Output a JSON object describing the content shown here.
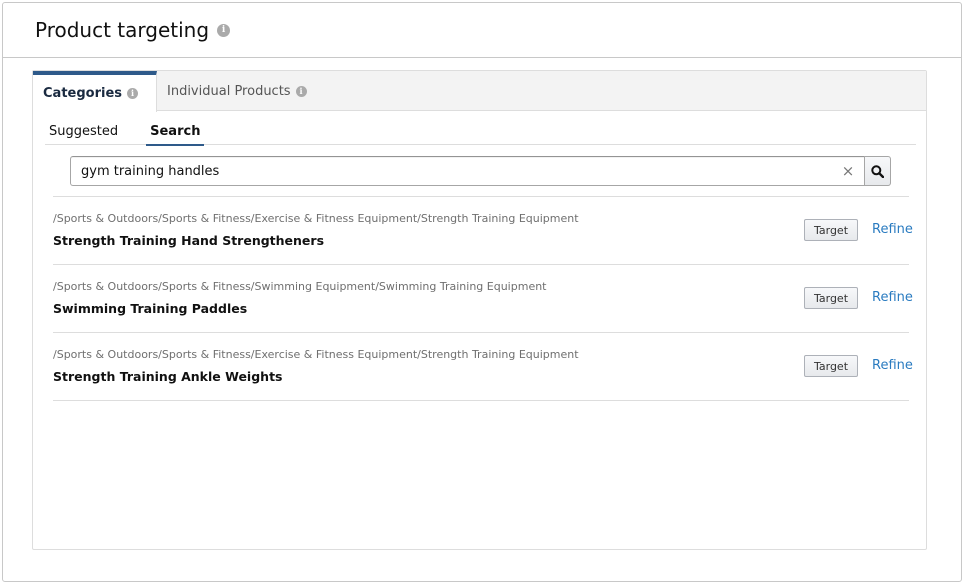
{
  "header": {
    "title": "Product targeting",
    "info_icon": "info-icon"
  },
  "tabs": [
    {
      "label": "Categories",
      "active": true
    },
    {
      "label": "Individual Products",
      "active": false
    }
  ],
  "subtabs": [
    {
      "label": "Suggested",
      "active": false
    },
    {
      "label": "Search",
      "active": true
    }
  ],
  "search": {
    "value": "gym training handles",
    "placeholder": "",
    "clear_glyph": "×",
    "search_icon": "search-icon"
  },
  "results": [
    {
      "path": "/Sports & Outdoors/Sports & Fitness/Exercise & Fitness Equipment/Strength Training Equipment",
      "name": "Strength Training Hand Strengtheners",
      "target_label": "Target",
      "refine_label": "Refine"
    },
    {
      "path": "/Sports & Outdoors/Sports & Fitness/Swimming Equipment/Swimming Training Equipment",
      "name": "Swimming Training Paddles",
      "target_label": "Target",
      "refine_label": "Refine"
    },
    {
      "path": "/Sports & Outdoors/Sports & Fitness/Exercise & Fitness Equipment/Strength Training Equipment",
      "name": "Strength Training Ankle Weights",
      "target_label": "Target",
      "refine_label": "Refine"
    }
  ],
  "colors": {
    "active_tab_accent": "#2e5a8a",
    "link": "#2a7bc0",
    "info_icon": "#aaaaaa"
  }
}
